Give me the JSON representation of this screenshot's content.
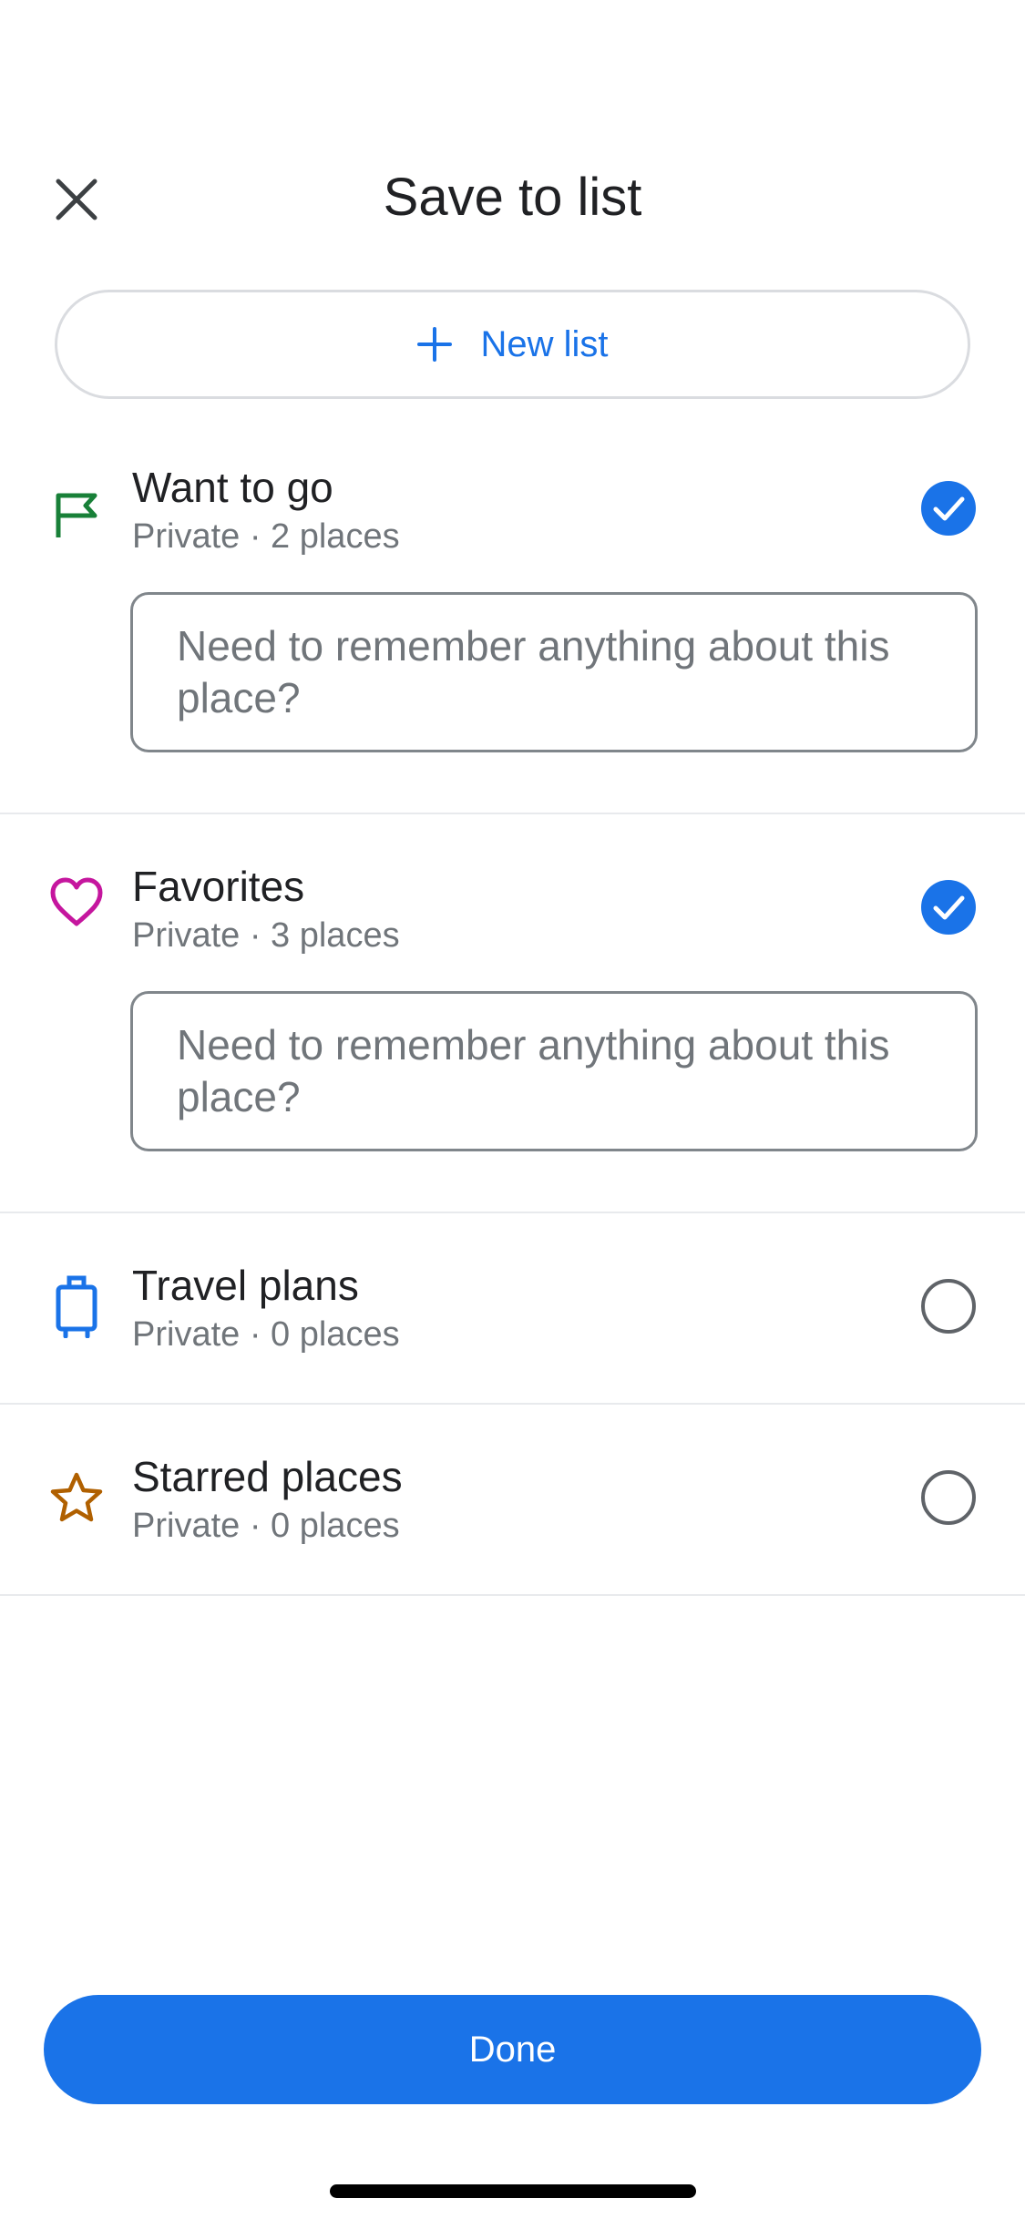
{
  "header": {
    "title": "Save to list",
    "close_icon": "close-icon"
  },
  "new_list": {
    "label": "New list",
    "icon": "plus-icon",
    "color": "#1a73e8"
  },
  "lists": [
    {
      "name": "Want to go",
      "subtitle": "Private · 2 places",
      "icon": "flag-icon",
      "icon_color": "#188038",
      "checked": true,
      "note_placeholder": "Need to remember anything about this place?"
    },
    {
      "name": "Favorites",
      "subtitle": "Private · 3 places",
      "icon": "heart-icon",
      "icon_color": "#c5169e",
      "checked": true,
      "note_placeholder": "Need to remember anything about this place?"
    },
    {
      "name": "Travel plans",
      "subtitle": "Private · 0 places",
      "icon": "suitcase-icon",
      "icon_color": "#1a73e8",
      "checked": false
    },
    {
      "name": "Starred places",
      "subtitle": "Private · 0 places",
      "icon": "star-icon",
      "icon_color": "#b06000",
      "checked": false
    }
  ],
  "done": {
    "label": "Done",
    "color": "#1a73e8"
  }
}
